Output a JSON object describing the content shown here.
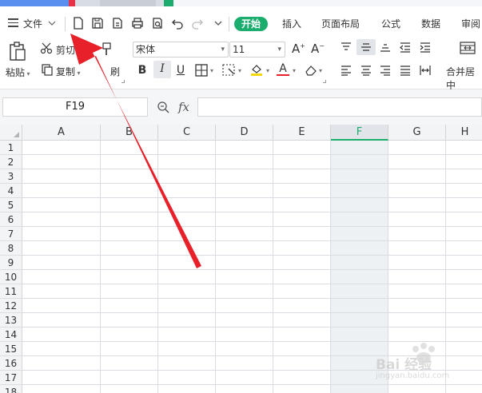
{
  "menu": {
    "file_label": "文件",
    "tabs": [
      {
        "label": "开始"
      },
      {
        "label": "插入"
      },
      {
        "label": "页面布局"
      },
      {
        "label": "公式"
      },
      {
        "label": "数据"
      },
      {
        "label": "审阅"
      }
    ]
  },
  "ribbon": {
    "paste_label": "粘贴",
    "cut_label": "剪切",
    "copy_label": "复制",
    "format_painter_label": "刷",
    "font_name": "宋体",
    "font_size": "11",
    "merge_label": "合并居中"
  },
  "formula_bar": {
    "name_box": "F19",
    "fx": "fx",
    "content": ""
  },
  "sheet": {
    "columns": [
      "A",
      "B",
      "C",
      "D",
      "E",
      "F",
      "G",
      "H"
    ],
    "selected_column": "F",
    "rows": [
      "1",
      "2",
      "3",
      "4",
      "5",
      "6",
      "7",
      "8",
      "9",
      "10",
      "11",
      "12",
      "13",
      "14",
      "15",
      "16",
      "17",
      "18"
    ]
  },
  "watermark": {
    "brand": "Bai 经验",
    "url": "jingyan.baidu.com"
  },
  "colors": {
    "accent_green": "#1aad6d",
    "arrow_red": "#e8202a"
  }
}
